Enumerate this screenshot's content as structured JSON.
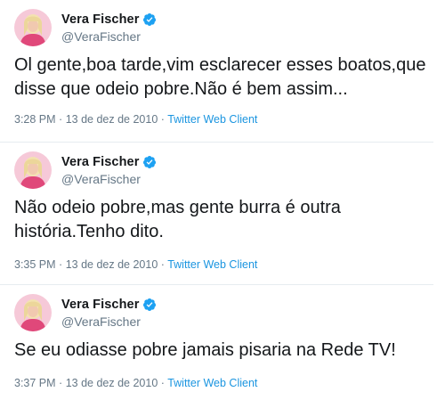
{
  "tweets": [
    {
      "name": "Vera Fischer",
      "handle": "@VeraFischer",
      "text": "Ol gente,boa tarde,vim esclarecer esses boatos,que disse que odeio pobre.Não é bem assim...",
      "time": "3:28 PM",
      "date": "13 de dez de 2010",
      "separator": "·",
      "client": "Twitter Web Client"
    },
    {
      "name": "Vera Fischer",
      "handle": "@VeraFischer",
      "text": "Não odeio pobre,mas gente burra é outra história.Tenho dito.",
      "time": "3:35 PM",
      "date": "13 de dez de 2010",
      "separator": "·",
      "client": "Twitter Web Client"
    },
    {
      "name": "Vera Fischer",
      "handle": "@VeraFischer",
      "text": "Se eu odiasse pobre jamais pisaria na Rede TV!",
      "time": "3:37 PM",
      "date": "13 de dez de 2010",
      "separator": "·",
      "client": "Twitter Web Client"
    }
  ],
  "icons": {
    "verified": "verified-badge-icon",
    "avatar": "profile-avatar"
  },
  "colors": {
    "accent": "#1b95e0",
    "verified": "#1da1f2",
    "muted": "#657786",
    "text": "#14171a",
    "divider": "#e6ecf0"
  }
}
